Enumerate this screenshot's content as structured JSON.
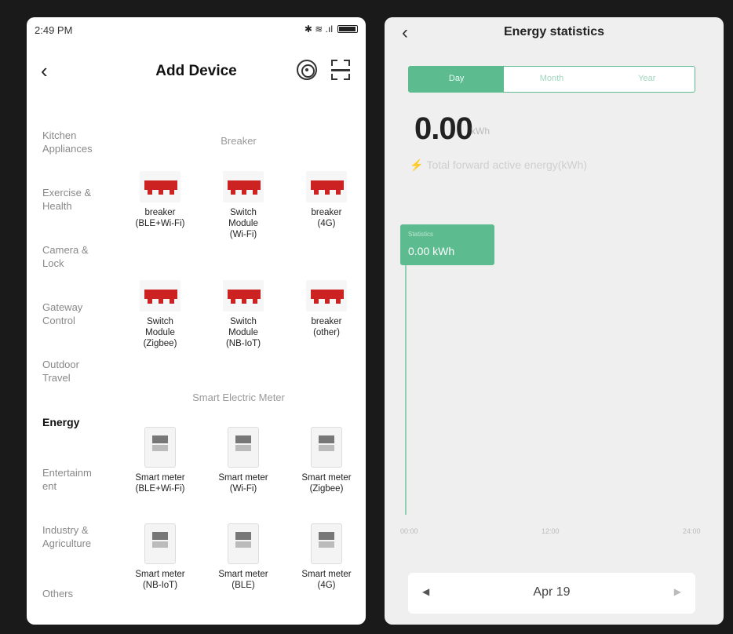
{
  "left": {
    "status": {
      "time": "2:49 PM",
      "icons_text": "✱ ≋ .ıl"
    },
    "header": {
      "title": "Add Device"
    },
    "sidebar": [
      {
        "label": "Kitchen\nAppliances",
        "active": false
      },
      {
        "label": "Exercise &\nHealth",
        "active": false
      },
      {
        "label": "Camera &\nLock",
        "active": false
      },
      {
        "label": "Gateway\nControl",
        "active": false
      },
      {
        "label": "Outdoor\nTravel",
        "active": false
      },
      {
        "label": "Energy",
        "active": true
      },
      {
        "label": "Entertainm\nent",
        "active": false
      },
      {
        "label": "Industry &\nAgriculture",
        "active": false
      },
      {
        "label": "Others",
        "active": false
      }
    ],
    "sections": [
      {
        "title": "Breaker"
      },
      {
        "title": "Smart Electric Meter"
      }
    ],
    "devices": [
      {
        "label": "breaker\n(BLE+Wi-Fi)",
        "icon": "breaker-icon"
      },
      {
        "label": "Switch\nModule\n(Wi-Fi)",
        "icon": "breaker-icon"
      },
      {
        "label": "breaker\n(4G)",
        "icon": "breaker-icon"
      },
      {
        "label": "Switch\nModule\n(Zigbee)",
        "icon": "breaker-icon"
      },
      {
        "label": "Switch\nModule\n(NB-IoT)",
        "icon": "breaker-icon"
      },
      {
        "label": "breaker\n(other)",
        "icon": "breaker-icon"
      },
      {
        "label": "Smart meter\n(BLE+Wi-Fi)",
        "icon": "meter-icon"
      },
      {
        "label": "Smart meter\n(Wi-Fi)",
        "icon": "meter-icon"
      },
      {
        "label": "Smart meter\n(Zigbee)",
        "icon": "meter-icon"
      },
      {
        "label": "Smart meter\n(NB-IoT)",
        "icon": "meter-icon"
      },
      {
        "label": "Smart meter\n(BLE)",
        "icon": "meter-icon"
      },
      {
        "label": "Smart meter\n(4G)",
        "icon": "meter-icon"
      }
    ]
  },
  "right": {
    "header": {
      "title": "Energy statistics"
    },
    "tabs": [
      {
        "label": "Day",
        "active": true
      },
      {
        "label": "Month",
        "active": false
      },
      {
        "label": "Year",
        "active": false
      }
    ],
    "value": "0.00",
    "unit": "kWh",
    "energy_label": "Total forward active energy(kWh)",
    "tooltip": {
      "label": "Statistics",
      "value": "0.00 kWh"
    },
    "x_ticks": [
      "00:00",
      "12:00",
      "24:00"
    ],
    "date": "Apr 19",
    "colors": {
      "accent": "#5cbb8f",
      "bolt": "#f1c232"
    }
  }
}
